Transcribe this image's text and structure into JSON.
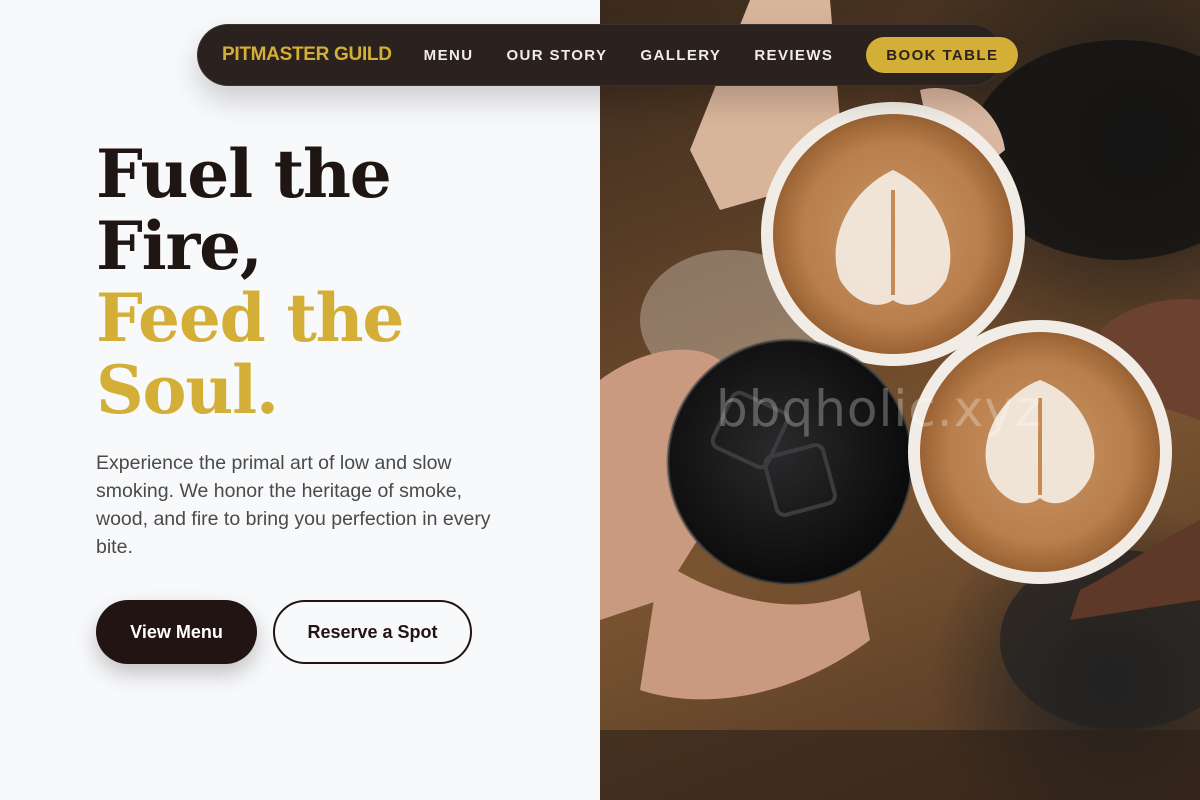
{
  "nav": {
    "brand": "PITMASTER GUILD",
    "links": [
      "MENU",
      "OUR STORY",
      "GALLERY",
      "REVIEWS"
    ],
    "cta": "BOOK TABLE"
  },
  "hero": {
    "title_lines": [
      "Fuel the",
      "Fire,"
    ],
    "accent_lines": [
      "Feed the",
      "Soul."
    ],
    "description": "Experience the primal art of low and slow smoking. We honor the heritage of smoke, wood, and fire to bring you perfection in every bite.",
    "primary_button": "View Menu",
    "secondary_button": "Reserve a Spot"
  },
  "image": {
    "watermark": "bbqholic.xyz"
  },
  "colors": {
    "accent": "#d4af37",
    "dark": "#221412",
    "nav_bg": "#2b2220",
    "page_bg": "#f8f9fb"
  }
}
